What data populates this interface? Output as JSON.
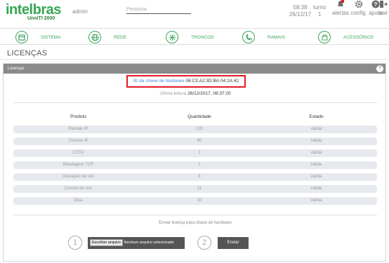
{
  "header": {
    "logo_text": "intelbras",
    "logo_sub": "UnniTI 2000",
    "user": "admin",
    "search_placeholder": "Pesquisa",
    "time": "08:38",
    "date": "26/12/17",
    "turno_label": "turno",
    "turno_value": "1",
    "icons": [
      {
        "label": "alertas",
        "icon": "bell-alert-icon"
      },
      {
        "label": "config.",
        "icon": "gear-icon"
      },
      {
        "label": "ajuda",
        "icon": "help-icon"
      },
      {
        "label": "sair",
        "icon": "logout-icon"
      }
    ]
  },
  "modules": [
    {
      "label": "SISTEMA",
      "icon": "system-icon"
    },
    {
      "label": "REDE",
      "icon": "network-icon"
    },
    {
      "label": "TRONCOS",
      "icon": "trunks-icon"
    },
    {
      "label": "RAMAIS",
      "icon": "extensions-icon"
    },
    {
      "label": "ACESSÓRIOS",
      "icon": "accessories-icon"
    }
  ],
  "page": {
    "title": "LICENÇAS",
    "panel_title": "Licenças",
    "help": "?"
  },
  "license": {
    "hw_key_label": "ID da chave de hardware",
    "hw_key_value": "06:C3:A2:3D:BA:04:2A:42",
    "last_read_label": "Última leitura",
    "last_read_value": "26/12/2017, 08:37:20"
  },
  "table": {
    "headers": [
      "Produto",
      "Quantidade",
      "Estado"
    ],
    "rows": [
      [
        "Ramais IP",
        "120",
        "válida"
      ],
      [
        "Troncos IP",
        "60",
        "válida"
      ],
      [
        "CSTA",
        "1",
        "válida"
      ],
      [
        "Bilhetagem TCP",
        "1",
        "válida"
      ],
      [
        "Gravação de voz",
        "8",
        "válida"
      ],
      [
        "Correio de Voz",
        "11",
        "válida"
      ],
      [
        "Disa",
        "10",
        "válida"
      ]
    ]
  },
  "upload": {
    "label": "Enviar licença para chave de hardware",
    "step1": "1",
    "step2": "2",
    "choose_button": "Escolher arquivo",
    "no_file": "Nenhum arquivo selecionado",
    "send_button": "Enviar"
  },
  "colors": {
    "brand": "#36a852",
    "panel_header": "#8a8a8a",
    "highlight": "#e01b24",
    "link": "#3b8bd9"
  }
}
